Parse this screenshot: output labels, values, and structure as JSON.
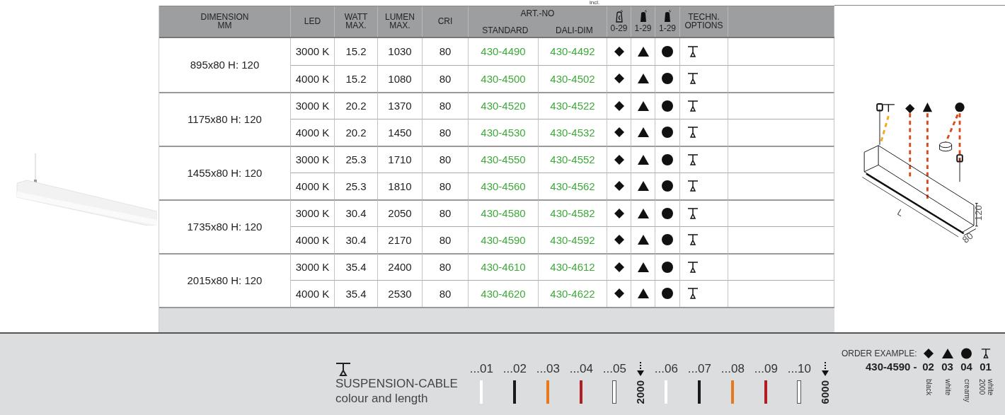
{
  "top_note": "incl.",
  "table": {
    "columns": {
      "dimension": [
        "DIMENSION",
        "MM"
      ],
      "led": "LED",
      "watt": [
        "WATT",
        "MAX."
      ],
      "lumen": [
        "LUMEN",
        "MAX."
      ],
      "cri": "CRI",
      "art_no": "ART.-NO",
      "standard": "STANDARD",
      "dali": "DALI-DIM",
      "techn": [
        "TECHN.",
        "OPTIONS"
      ]
    },
    "color_columns": [
      {
        "kind": "ceiling-c",
        "range": "0-29"
      },
      {
        "kind": "ceiling",
        "range": "1-29"
      },
      {
        "kind": "ceiling",
        "range": "1-29"
      }
    ],
    "groups": [
      {
        "dimension": "895x80 H: 120",
        "rows": [
          {
            "led": "3000 K",
            "watt": "15.2",
            "lumen": "1030",
            "cri": "80",
            "standard": "430-4490",
            "dali": "430-4492"
          },
          {
            "led": "4000 K",
            "watt": "15.2",
            "lumen": "1080",
            "cri": "80",
            "standard": "430-4500",
            "dali": "430-4502"
          }
        ]
      },
      {
        "dimension": "1175x80 H: 120",
        "rows": [
          {
            "led": "3000 K",
            "watt": "20.2",
            "lumen": "1370",
            "cri": "80",
            "standard": "430-4520",
            "dali": "430-4522"
          },
          {
            "led": "4000 K",
            "watt": "20.2",
            "lumen": "1450",
            "cri": "80",
            "standard": "430-4530",
            "dali": "430-4532"
          }
        ]
      },
      {
        "dimension": "1455x80 H: 120",
        "rows": [
          {
            "led": "3000 K",
            "watt": "25.3",
            "lumen": "1710",
            "cri": "80",
            "standard": "430-4550",
            "dali": "430-4552"
          },
          {
            "led": "4000 K",
            "watt": "25.3",
            "lumen": "1810",
            "cri": "80",
            "standard": "430-4560",
            "dali": "430-4562"
          }
        ]
      },
      {
        "dimension": "1735x80 H: 120",
        "rows": [
          {
            "led": "3000 K",
            "watt": "30.4",
            "lumen": "2050",
            "cri": "80",
            "standard": "430-4580",
            "dali": "430-4582"
          },
          {
            "led": "4000 K",
            "watt": "30.4",
            "lumen": "2170",
            "cri": "80",
            "standard": "430-4590",
            "dali": "430-4592"
          }
        ]
      },
      {
        "dimension": "2015x80 H: 120",
        "rows": [
          {
            "led": "3000 K",
            "watt": "35.4",
            "lumen": "2400",
            "cri": "80",
            "standard": "430-4610",
            "dali": "430-4612"
          },
          {
            "led": "4000 K",
            "watt": "35.4",
            "lumen": "2530",
            "cri": "80",
            "standard": "430-4620",
            "dali": "430-4622"
          }
        ]
      }
    ]
  },
  "diagram": {
    "length_label": "L",
    "height_label": "120",
    "width_label": "80"
  },
  "cable": {
    "title": "SUSPENSION-CABLE",
    "subtitle": "colour and length",
    "options": [
      {
        "kind": "swatch",
        "code": "...01",
        "color": "#ffffff"
      },
      {
        "kind": "swatch",
        "code": "...02",
        "color": "#1a1a1a"
      },
      {
        "kind": "swatch",
        "code": "...03",
        "color": "#e8781e"
      },
      {
        "kind": "swatch",
        "code": "...04",
        "color": "#b01e24"
      },
      {
        "kind": "outline",
        "code": "...05"
      },
      {
        "kind": "length",
        "label": "2000"
      },
      {
        "kind": "swatch",
        "code": "...06",
        "color": "#ffffff"
      },
      {
        "kind": "swatch",
        "code": "...07",
        "color": "#1a1a1a"
      },
      {
        "kind": "swatch",
        "code": "...08",
        "color": "#e8781e"
      },
      {
        "kind": "swatch",
        "code": "...09",
        "color": "#b01e24"
      },
      {
        "kind": "outline",
        "code": "...10"
      },
      {
        "kind": "length",
        "label": "6000"
      }
    ]
  },
  "order_example": {
    "label": "ORDER EXAMPLE:",
    "code": "430-4590 -",
    "parts": [
      {
        "kind": "diamond",
        "code": "02",
        "notes": [
          "black"
        ]
      },
      {
        "kind": "triangle",
        "code": "03",
        "notes": [
          "white"
        ]
      },
      {
        "kind": "circle",
        "code": "04",
        "notes": [
          "creamy"
        ]
      },
      {
        "kind": "suspension",
        "code": "01",
        "notes": [
          "white",
          "2000"
        ]
      }
    ]
  }
}
